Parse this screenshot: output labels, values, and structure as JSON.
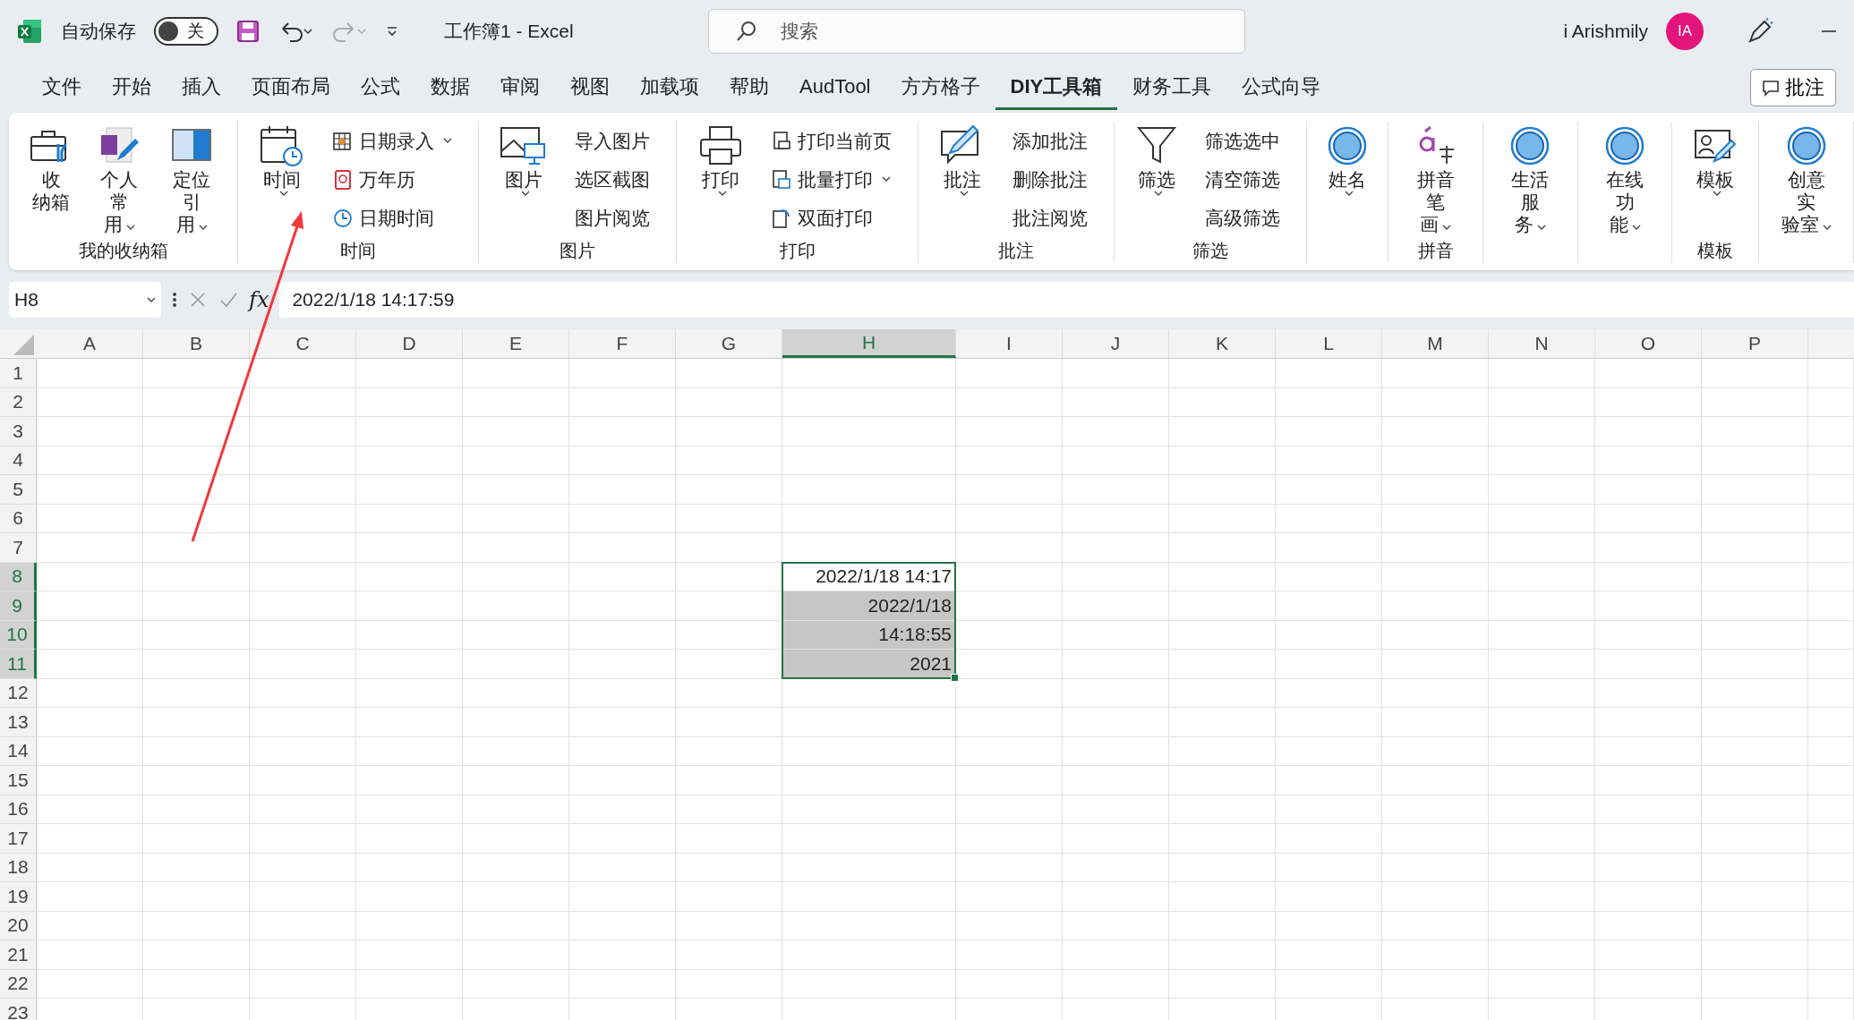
{
  "title_bar": {
    "autosave_label": "自动保存",
    "autosave": {
      "on": false,
      "label": "关"
    },
    "document_title": "工作簿1  -  Excel",
    "search": {
      "placeholder": "搜索"
    },
    "user_name": "i Arishmily",
    "avatar_initials": "IA"
  },
  "menu_tabs": [
    {
      "label": "文件",
      "selected": false
    },
    {
      "label": "开始",
      "selected": false
    },
    {
      "label": "插入",
      "selected": false
    },
    {
      "label": "页面布局",
      "selected": false
    },
    {
      "label": "公式",
      "selected": false
    },
    {
      "label": "数据",
      "selected": false
    },
    {
      "label": "审阅",
      "selected": false
    },
    {
      "label": "视图",
      "selected": false
    },
    {
      "label": "加载项",
      "selected": false
    },
    {
      "label": "帮助",
      "selected": false
    },
    {
      "label": "AudTool",
      "selected": false
    },
    {
      "label": "方方格子",
      "selected": false
    },
    {
      "label": "DIY工具箱",
      "selected": true
    },
    {
      "label": "财务工具",
      "selected": false
    },
    {
      "label": "公式向导",
      "selected": false
    }
  ],
  "comments_button": "批注",
  "ribbon": {
    "groups": [
      {
        "label": "我的收纳箱",
        "items": [
          {
            "kind": "large",
            "lines": [
              "收",
              "纳箱"
            ],
            "dropdown": false
          },
          {
            "kind": "large",
            "lines": [
              "个人常",
              "用"
            ],
            "dropdown": true
          },
          {
            "kind": "large",
            "lines": [
              "定位引",
              "用"
            ],
            "dropdown": true
          }
        ]
      },
      {
        "label": "时间",
        "items": [
          {
            "kind": "large",
            "lines": [
              "时间"
            ],
            "dropdown": true
          },
          {
            "kind": "small",
            "label": "日期录入",
            "dropdown": true
          },
          {
            "kind": "small",
            "label": "万年历",
            "dropdown": false
          },
          {
            "kind": "small",
            "label": "日期时间",
            "dropdown": false
          }
        ]
      },
      {
        "label": "图片",
        "items": [
          {
            "kind": "large",
            "lines": [
              "图片"
            ],
            "dropdown": true
          },
          {
            "kind": "text",
            "label": "导入图片"
          },
          {
            "kind": "text",
            "label": "选区截图"
          },
          {
            "kind": "text",
            "label": "图片阅览"
          }
        ]
      },
      {
        "label": "打印",
        "items": [
          {
            "kind": "large",
            "lines": [
              "打印"
            ],
            "dropdown": true
          },
          {
            "kind": "small",
            "label": "打印当前页",
            "dropdown": false
          },
          {
            "kind": "small",
            "label": "批量打印",
            "dropdown": true
          },
          {
            "kind": "small",
            "label": "双面打印",
            "dropdown": false
          }
        ]
      },
      {
        "label": "批注",
        "items": [
          {
            "kind": "large",
            "lines": [
              "批注"
            ],
            "dropdown": true
          },
          {
            "kind": "text",
            "label": "添加批注"
          },
          {
            "kind": "text",
            "label": "删除批注"
          },
          {
            "kind": "text",
            "label": "批注阅览"
          }
        ]
      },
      {
        "label": "筛选",
        "items": [
          {
            "kind": "large",
            "lines": [
              "筛选"
            ],
            "dropdown": true
          },
          {
            "kind": "text",
            "label": "筛选选中"
          },
          {
            "kind": "text",
            "label": "清空筛选"
          },
          {
            "kind": "text",
            "label": "高级筛选"
          }
        ]
      },
      {
        "items": [
          {
            "kind": "large",
            "lines": [
              "姓名"
            ],
            "dropdown": true
          }
        ]
      },
      {
        "label": "拼音",
        "items": [
          {
            "kind": "large",
            "lines": [
              "拼音笔",
              "画"
            ],
            "dropdown": true
          }
        ]
      },
      {
        "items": [
          {
            "kind": "large",
            "lines": [
              "生活服",
              "务"
            ],
            "dropdown": true
          }
        ]
      },
      {
        "items": [
          {
            "kind": "large",
            "lines": [
              "在线功",
              "能"
            ],
            "dropdown": true
          }
        ]
      },
      {
        "label": "模板",
        "items": [
          {
            "kind": "large",
            "lines": [
              "模板"
            ],
            "dropdown": true
          }
        ]
      },
      {
        "items": [
          {
            "kind": "large",
            "lines": [
              "创意实",
              "验室"
            ],
            "dropdown": true
          }
        ]
      }
    ]
  },
  "formula_bar": {
    "name_box": "H8",
    "function_label": "fx",
    "value": "2022/1/18  14:17:59"
  },
  "sheet": {
    "columns": [
      {
        "label": "A",
        "selected": false
      },
      {
        "label": "B",
        "selected": false
      },
      {
        "label": "C",
        "selected": false
      },
      {
        "label": "D",
        "selected": false
      },
      {
        "label": "E",
        "selected": false
      },
      {
        "label": "F",
        "selected": false
      },
      {
        "label": "G",
        "selected": false
      },
      {
        "label": "H",
        "selected": true
      },
      {
        "label": "I",
        "selected": false
      },
      {
        "label": "J",
        "selected": false
      },
      {
        "label": "K",
        "selected": false
      },
      {
        "label": "L",
        "selected": false
      },
      {
        "label": "M",
        "selected": false
      },
      {
        "label": "N",
        "selected": false
      },
      {
        "label": "O",
        "selected": false
      },
      {
        "label": "P",
        "selected": false
      }
    ],
    "rows": [
      {
        "label": "1",
        "selected": false
      },
      {
        "label": "2",
        "selected": false
      },
      {
        "label": "3",
        "selected": false
      },
      {
        "label": "4",
        "selected": false
      },
      {
        "label": "5",
        "selected": false
      },
      {
        "label": "6",
        "selected": false
      },
      {
        "label": "7",
        "selected": false
      },
      {
        "label": "8",
        "selected": true,
        "cell_h": {
          "value": "2022/1/18 14:17",
          "active": true
        }
      },
      {
        "label": "9",
        "selected": true,
        "cell_h": {
          "value": "2022/1/18",
          "active": false
        }
      },
      {
        "label": "10",
        "selected": true,
        "cell_h": {
          "value": "14:18:55",
          "active": false
        }
      },
      {
        "label": "11",
        "selected": true,
        "cell_h": {
          "value": "2021",
          "active": false
        }
      },
      {
        "label": "12",
        "selected": false
      },
      {
        "label": "13",
        "selected": false
      },
      {
        "label": "14",
        "selected": false
      },
      {
        "label": "15",
        "selected": false
      },
      {
        "label": "16",
        "selected": false
      },
      {
        "label": "17",
        "selected": false
      },
      {
        "label": "18",
        "selected": false
      },
      {
        "label": "19",
        "selected": false
      },
      {
        "label": "20",
        "selected": false
      },
      {
        "label": "21",
        "selected": false
      },
      {
        "label": "22",
        "selected": false
      },
      {
        "label": "23",
        "selected": false
      }
    ]
  }
}
